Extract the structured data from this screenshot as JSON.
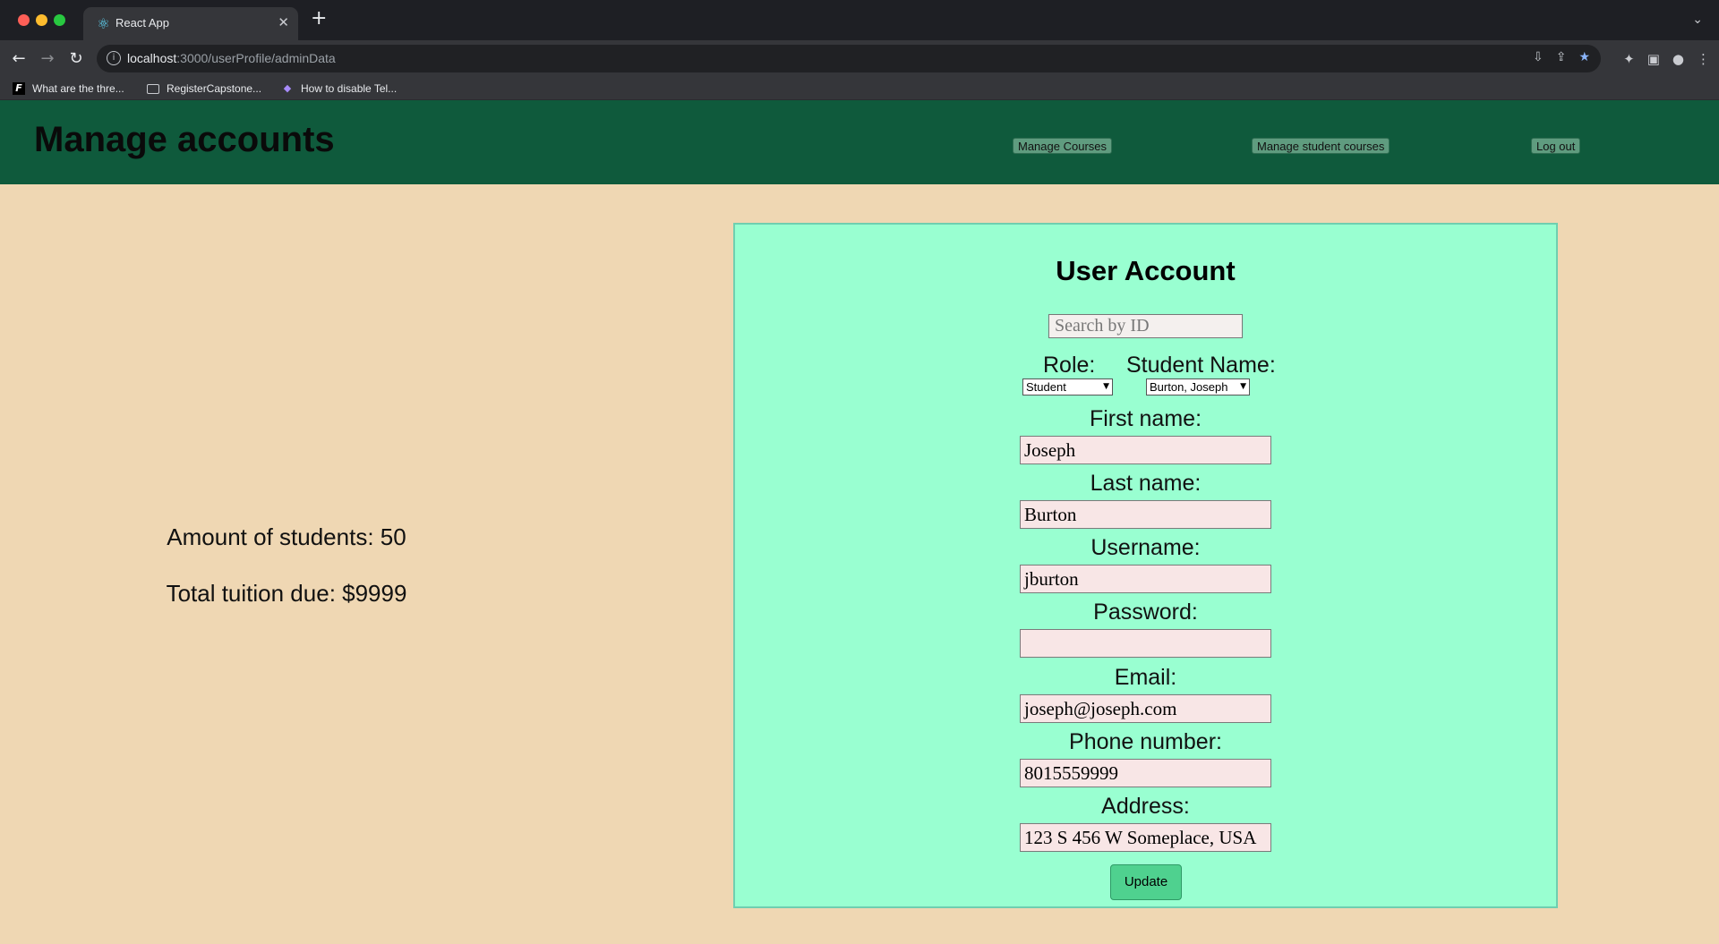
{
  "browser": {
    "tab_title": "React App",
    "tab_icon": "react-icon",
    "url_host": "localhost",
    "url_path": ":3000/userProfile/adminData",
    "bookmarks": [
      {
        "label": "What are the thre...",
        "icon": "f-logo-icon"
      },
      {
        "label": "RegisterCapstone...",
        "icon": "folder-icon"
      },
      {
        "label": "How to disable Tel...",
        "icon": "gem-icon"
      }
    ]
  },
  "header": {
    "title": "Manage accounts",
    "buttons": {
      "manage_courses": "Manage Courses",
      "manage_student_courses": "Manage student courses",
      "logout": "Log out"
    },
    "bg_color": "#0f5a3c"
  },
  "stats": {
    "students": "Amount of students: 50",
    "tuition": "Total tuition due: $9999"
  },
  "account": {
    "title": "User Account",
    "search_placeholder": "Search by ID",
    "role_label": "Role:",
    "role_value": "Student",
    "student_name_label": "Student Name:",
    "student_name_value": "Burton, Joseph",
    "fields": {
      "first_name": {
        "label": "First name:",
        "value": "Joseph"
      },
      "last_name": {
        "label": "Last name:",
        "value": "Burton"
      },
      "username": {
        "label": "Username:",
        "value": "jburton"
      },
      "password": {
        "label": "Password:",
        "value": ""
      },
      "email": {
        "label": "Email:",
        "value": "joseph@joseph.com"
      },
      "phone": {
        "label": "Phone number:",
        "value": "8015559999"
      },
      "address": {
        "label": "Address:",
        "value": "123 S 456 W Someplace, USA"
      }
    },
    "update_label": "Update",
    "panel_color": "#99ffd1"
  }
}
